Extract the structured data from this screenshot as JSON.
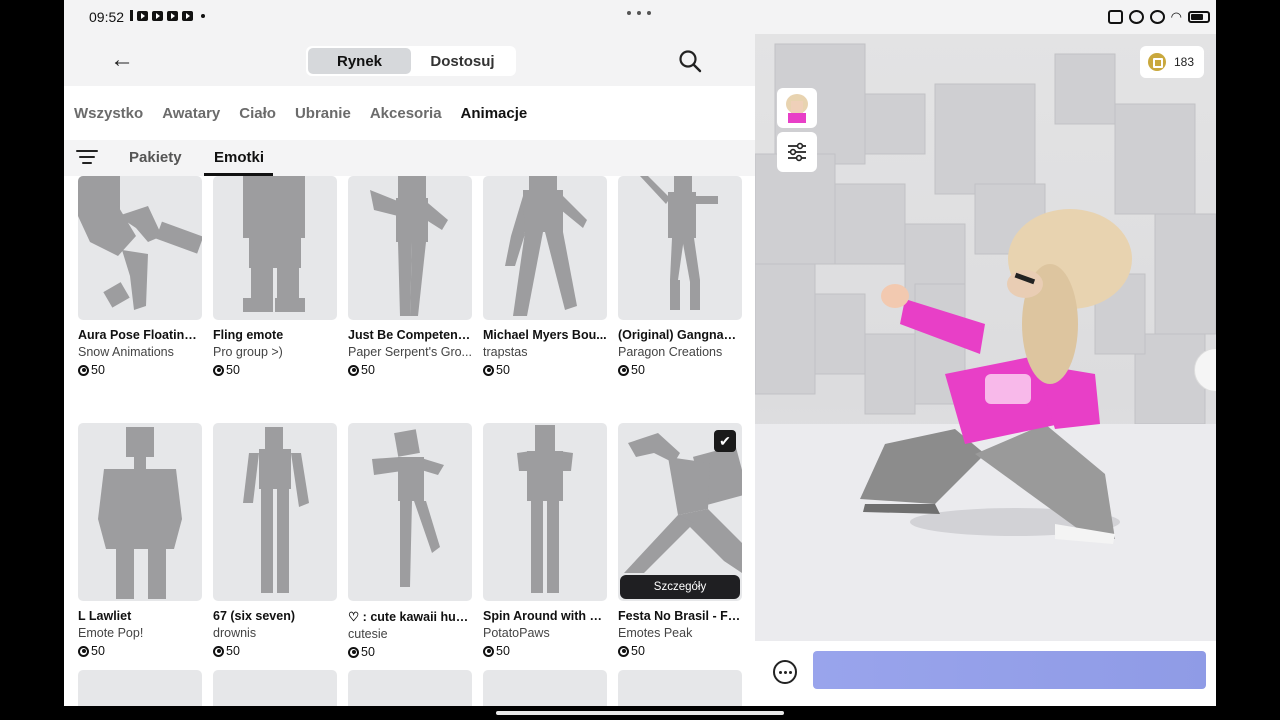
{
  "status": {
    "time": "09:52"
  },
  "header": {
    "tabs": [
      "Rynek",
      "Dostosuj"
    ],
    "active_tab": "Rynek"
  },
  "categories": [
    "Wszystko",
    "Awatary",
    "Ciało",
    "Ubranie",
    "Akcesoria",
    "Animacje"
  ],
  "active_category": "Animacje",
  "subcategories": [
    "Pakiety",
    "Emotki"
  ],
  "active_subcategory": "Emotki",
  "items": [
    {
      "name": "Aura Pose Floating ...",
      "creator": "Snow Animations",
      "price": "50"
    },
    {
      "name": "Fling emote",
      "creator": "Pro group >)",
      "price": "50"
    },
    {
      "name": "Just Be Competent ...",
      "creator": "Paper Serpent's Gro...",
      "price": "50"
    },
    {
      "name": "Michael Myers Bou...",
      "creator": "trapstas",
      "price": "50"
    },
    {
      "name": "(Original) Gangnam ...",
      "creator": "Paragon Creations",
      "price": "50"
    },
    {
      "name": "L Lawliet",
      "creator": "Emote Pop!",
      "price": "50"
    },
    {
      "name": "67 (six seven)",
      "creator": "drownis",
      "price": "50"
    },
    {
      "name": "♡ : cute kawaii hug...",
      "creator": "cutesie",
      "price": "50"
    },
    {
      "name": "Spin Around with a ...",
      "creator": "PotatoPaws",
      "price": "50"
    },
    {
      "name": "Festa No Brasil - For...",
      "creator": "Emotes Peak",
      "price": "50",
      "selected": true,
      "details_label": "Szczegóły"
    }
  ],
  "avatar_view": {
    "robux_balance": "183"
  },
  "colors": {
    "accent_chat": "#8f9be6",
    "avatar_shirt": "#e83fc7",
    "robux_coin": "#c9a83d"
  }
}
